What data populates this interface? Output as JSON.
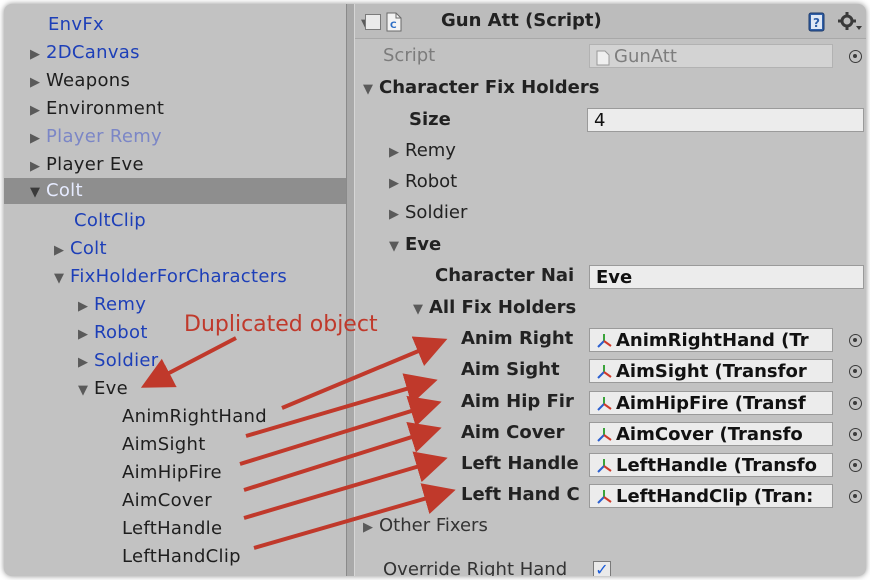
{
  "hierarchy": {
    "items": [
      {
        "label": "EnvFx",
        "arrow": "",
        "color": "blue"
      },
      {
        "label": "2DCanvas",
        "arrow": "▶",
        "color": "blue"
      },
      {
        "label": "Weapons",
        "arrow": "▶",
        "color": "black"
      },
      {
        "label": "Environment",
        "arrow": "▶",
        "color": "black"
      },
      {
        "label": "Player Remy",
        "arrow": "▶",
        "color": "lightblue"
      },
      {
        "label": "Player Eve",
        "arrow": "▶",
        "color": "black"
      },
      {
        "label": "Colt",
        "arrow": "▼",
        "color": "selected"
      },
      {
        "label": "ColtClip",
        "arrow": "",
        "color": "blue"
      },
      {
        "label": "Colt",
        "arrow": "▶",
        "color": "blue"
      },
      {
        "label": "FixHolderForCharacters",
        "arrow": "▼",
        "color": "blue"
      },
      {
        "label": "Remy",
        "arrow": "▶",
        "color": "blue"
      },
      {
        "label": "Robot",
        "arrow": "▶",
        "color": "blue"
      },
      {
        "label": "Soldier",
        "arrow": "▶",
        "color": "blue"
      },
      {
        "label": "Eve",
        "arrow": "▼",
        "color": "black"
      },
      {
        "label": "AnimRightHand",
        "arrow": "",
        "color": "black"
      },
      {
        "label": "AimSight",
        "arrow": "",
        "color": "black"
      },
      {
        "label": "AimHipFire",
        "arrow": "",
        "color": "black"
      },
      {
        "label": "AimCover",
        "arrow": "",
        "color": "black"
      },
      {
        "label": "LeftHandle",
        "arrow": "",
        "color": "black"
      },
      {
        "label": "LeftHandClip",
        "arrow": "",
        "color": "black"
      }
    ]
  },
  "inspector": {
    "component_title": "Gun Att (Script)",
    "fold_arrow": "▼",
    "check_mark": "✓",
    "script_icon": "script-file-icon",
    "help_icon": "help-book-icon",
    "settings_icon": "gear-icon",
    "script_label": "Script",
    "script_value": "GunAtt",
    "character_fix_holders": "Character Fix Holders",
    "size_label": "Size",
    "size_value": "4",
    "elements": [
      "Remy",
      "Robot",
      "Soldier",
      "Eve"
    ],
    "character_name_label": "Character Nai",
    "character_name_value": "Eve",
    "all_fix_holders": "All Fix Holders",
    "fix_holders": [
      {
        "label": "Anim Right",
        "value": "AnimRightHand (Tr"
      },
      {
        "label": "Aim Sight",
        "value": "AimSight (Transfor"
      },
      {
        "label": "Aim Hip Fir",
        "value": "AimHipFire (Transf"
      },
      {
        "label": "Aim Cover",
        "value": "AimCover (Transfo"
      },
      {
        "label": "Left Handle",
        "value": "LeftHandle (Transfo"
      },
      {
        "label": "Left Hand C",
        "value": "LeftHandClip (Tran:"
      }
    ],
    "other_fixers": "Other Fixers",
    "override_right_hand": "Override Right Hand",
    "override_checked": true
  },
  "annotation": {
    "text": "Duplicated object",
    "color": "#c0392b"
  },
  "colors": {
    "panel_bg": "#c2c2c2",
    "selection": "#8e8e8e",
    "prefab_blue": "#1d3fb8",
    "arrow_red": "#c0392b"
  }
}
